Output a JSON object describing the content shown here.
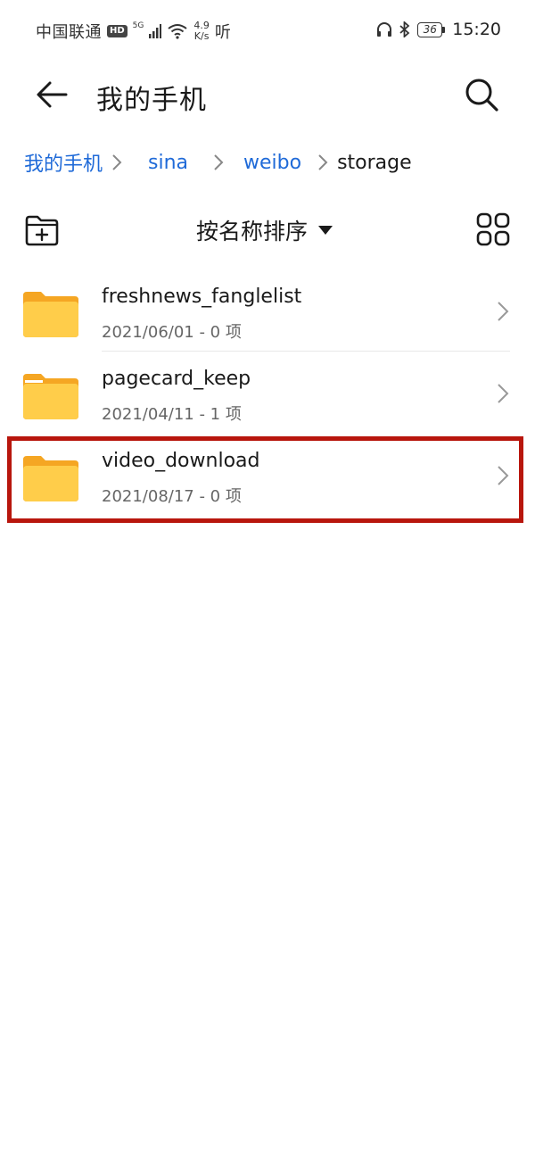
{
  "status_bar": {
    "carrier": "中国联通",
    "hd_badge": "HD",
    "network": "5G",
    "speed_value": "4.9",
    "speed_unit": "K/s",
    "extra_icon_text": "听",
    "battery": "36",
    "time": "15:20"
  },
  "header": {
    "title": "我的手机"
  },
  "breadcrumb": {
    "items": [
      "我的手机",
      "sina",
      "weibo",
      "storage"
    ]
  },
  "toolbar": {
    "sort_label": "按名称排序"
  },
  "files": [
    {
      "name": "freshnews_fanglelist",
      "meta": "2021/06/01 - 0 项"
    },
    {
      "name": "pagecard_keep",
      "meta": "2021/04/11 - 1 项"
    },
    {
      "name": "video_download",
      "meta": "2021/08/17 - 0 项"
    }
  ],
  "colors": {
    "accent_link": "#1f6ad8",
    "folder": "#ffcd4a",
    "folder_tab": "#f5a623",
    "highlight": "#b8160d"
  }
}
